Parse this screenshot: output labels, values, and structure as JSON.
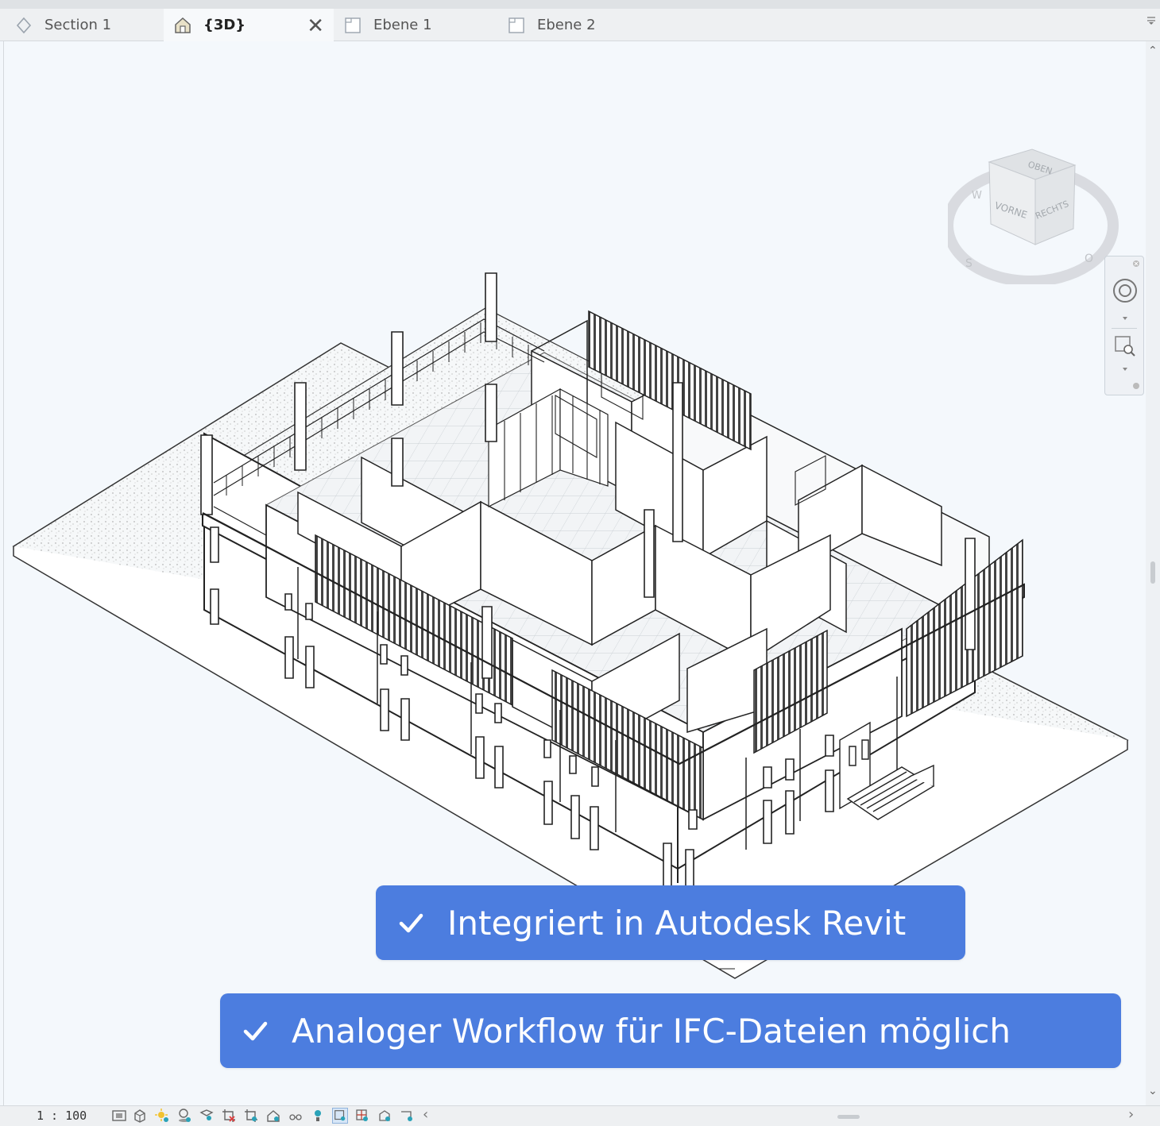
{
  "tabs": [
    {
      "label": "Section 1",
      "icon": "section-icon",
      "active": false
    },
    {
      "label": "{3D}",
      "icon": "house-3d-icon",
      "active": true,
      "closable": true
    },
    {
      "label": "Ebene 1",
      "icon": "floor-plan-icon",
      "active": false
    },
    {
      "label": "Ebene 2",
      "icon": "floor-plan-icon",
      "active": false
    }
  ],
  "viewcube": {
    "top_label": "OBEN",
    "front_label": "VORNE",
    "right_label": "RECHTS",
    "compass_w": "W",
    "compass_s": "S",
    "compass_o": "O"
  },
  "callouts": [
    {
      "text": "Integriert in Autodesk Revit"
    },
    {
      "text": "Analoger Workflow für IFC-Dateien möglich"
    }
  ],
  "statusbar": {
    "scale": "1 : 100",
    "icons": [
      "detail-level-icon",
      "visual-style-icon",
      "sun-path-icon",
      "shadows-icon",
      "render-icon",
      "crop-view-icon",
      "show-crop-icon",
      "unlocked-3d-icon",
      "temporary-hide-icon",
      "reveal-hidden-icon",
      "worksharing-icon",
      "design-options-icon",
      "highlight-displacement-icon",
      "analytical-model-icon"
    ]
  },
  "colors": {
    "callout_bg": "#4c7ddf",
    "viewport_bg": "#f4f8fc",
    "tabbar_bg": "#eef0f2"
  }
}
